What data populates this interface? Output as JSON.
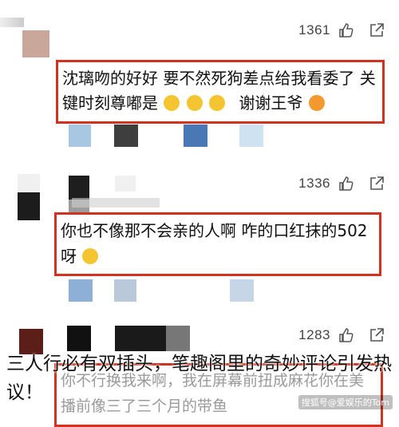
{
  "comments": [
    {
      "likes": "1361",
      "text_line1": "沈璃吻的好好 要不然死狗差点给我看委了 关",
      "text_line2": "键时刻尊嘟是",
      "text_line2_suffix": "谢谢王爷"
    },
    {
      "likes": "1336",
      "text_line1": "你也不像那不会亲的人啊 咋的口红抹的502",
      "text_line2": "呀"
    },
    {
      "likes": "1283",
      "partial_line1": "你不行换我来啊，我在屏幕前扭成麻花你在美",
      "partial_line2": "播前像三了三个月的带鱼"
    }
  ],
  "caption": "三人行必有双插头，笔趣阁里的奇妙评论引发热议！",
  "watermark": "搜狐号@爱娱乐的Tom",
  "colors": {
    "highlight_border": "#d0331f",
    "meta_text": "#444444"
  },
  "icons": {
    "like": "thumbs-up-icon",
    "share": "share-arrow-icon"
  }
}
